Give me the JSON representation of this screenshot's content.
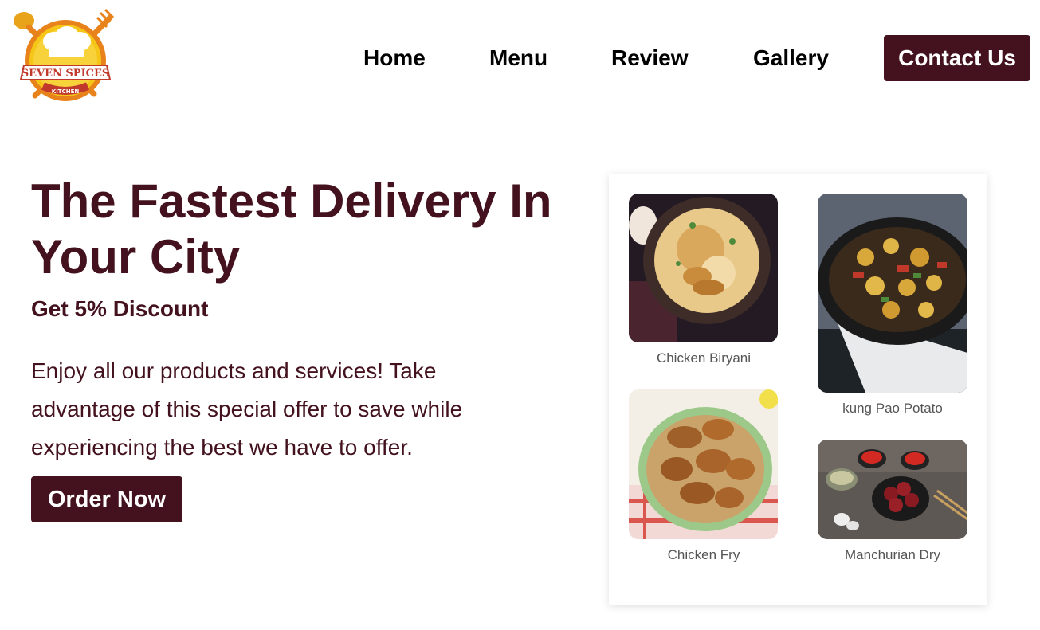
{
  "brand": {
    "logo_line1": "SEVEN SPICES",
    "logo_line2": "KITCHEN",
    "colors": {
      "primary": "#43121e",
      "logo_orange": "#e8821a",
      "logo_yellow": "#f5c518",
      "logo_red": "#c0392b"
    }
  },
  "nav": {
    "items": [
      {
        "label": "Home"
      },
      {
        "label": "Menu"
      },
      {
        "label": "Review"
      },
      {
        "label": "Gallery"
      }
    ],
    "contact_label": "Contact Us"
  },
  "hero": {
    "title": "The Fastest Delivery In Your City",
    "subtitle": "Get 5% Discount",
    "text": "Enjoy all our products and services! Take advantage of this special offer to save while experiencing the best we have to offer.",
    "cta_label": "Order Now"
  },
  "menu_items": [
    {
      "name": "Chicken Biryani",
      "image": "biryani-plate"
    },
    {
      "name": "kung Pao Potato",
      "image": "pan-potatoes"
    },
    {
      "name": "Chicken Fry",
      "image": "fried-chicken-basket"
    },
    {
      "name": "Manchurian Dry",
      "image": "manchurian-bowl"
    }
  ]
}
